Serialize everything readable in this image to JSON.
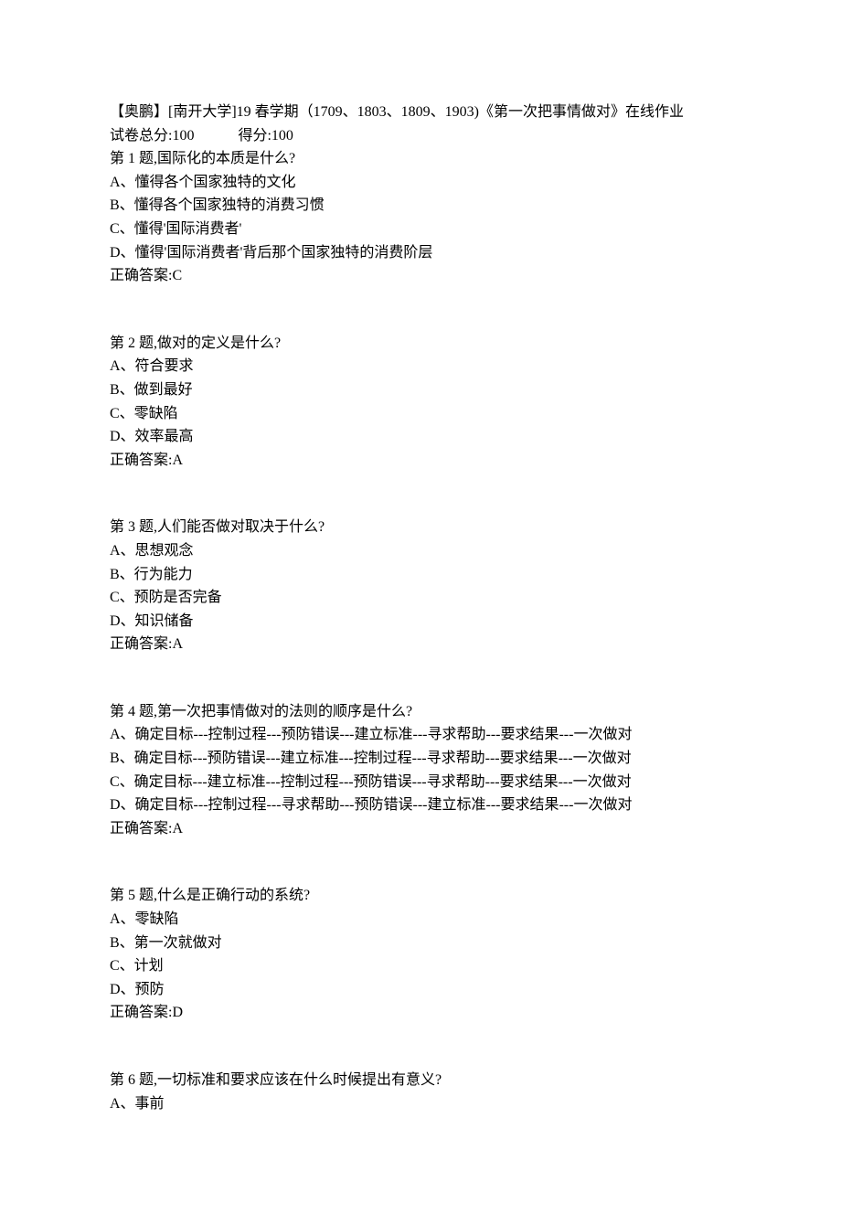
{
  "header": {
    "title": "【奥鹏】[南开大学]19 春学期（1709、1803、1809、1903)《第一次把事情做对》在线作业",
    "score_prefix": "试卷总分:100",
    "score_suffix": "得分:100"
  },
  "questions": [
    {
      "prompt": "第 1 题,国际化的本质是什么?",
      "options": [
        "A、懂得各个国家独特的文化",
        "B、懂得各个国家独特的消费习惯",
        "C、懂得'国际消费者'",
        "D、懂得'国际消费者'背后那个国家独特的消费阶层"
      ],
      "answer": "正确答案:C"
    },
    {
      "prompt": "第 2 题,做对的定义是什么?",
      "options": [
        "A、符合要求",
        "B、做到最好",
        "C、零缺陷",
        "D、效率最高"
      ],
      "answer": "正确答案:A"
    },
    {
      "prompt": "第 3 题,人们能否做对取决于什么?",
      "options": [
        "A、思想观念",
        "B、行为能力",
        "C、预防是否完备",
        "D、知识储备"
      ],
      "answer": "正确答案:A"
    },
    {
      "prompt": "第 4 题,第一次把事情做对的法则的顺序是什么?",
      "options": [
        "A、确定目标---控制过程---预防错误---建立标准---寻求帮助---要求结果---一次做对",
        "B、确定目标---预防错误---建立标准---控制过程---寻求帮助---要求结果---一次做对",
        "C、确定目标---建立标准---控制过程---预防错误---寻求帮助---要求结果---一次做对",
        "D、确定目标---控制过程---寻求帮助---预防错误---建立标准---要求结果---一次做对"
      ],
      "answer": "正确答案:A"
    },
    {
      "prompt": "第 5 题,什么是正确行动的系统?",
      "options": [
        "A、零缺陷",
        "B、第一次就做对",
        "C、计划",
        "D、预防"
      ],
      "answer": "正确答案:D"
    },
    {
      "prompt": "第 6 题,一切标准和要求应该在什么时候提出有意义?",
      "options": [
        "A、事前"
      ],
      "answer": null
    }
  ]
}
